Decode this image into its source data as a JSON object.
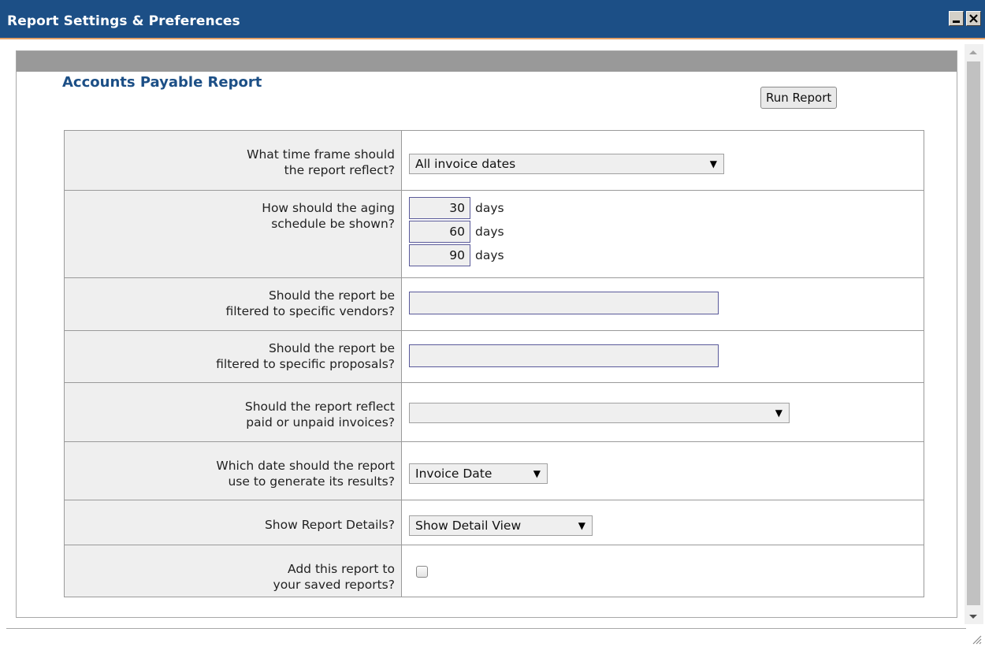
{
  "window": {
    "title": "Report Settings & Preferences"
  },
  "report": {
    "title": "Accounts Payable Report",
    "run_button": "Run Report"
  },
  "form": {
    "time_frame": {
      "question_line1": "What time frame should",
      "question_line2": "the report reflect?",
      "selected": "All invoice dates"
    },
    "aging": {
      "question_line1": "How should the aging",
      "question_line2": "schedule be shown?",
      "day1": "30",
      "day2": "60",
      "day3": "90",
      "unit": "days"
    },
    "vendors": {
      "question_line1": "Should the report be",
      "question_line2": "filtered to specific vendors?",
      "value": ""
    },
    "proposals": {
      "question_line1": "Should the report be",
      "question_line2": "filtered to specific proposals?",
      "value": ""
    },
    "paid_unpaid": {
      "question_line1": "Should the report reflect",
      "question_line2": "paid or unpaid invoices?",
      "selected": ""
    },
    "date_basis": {
      "question_line1": "Which date should the report",
      "question_line2": "use to generate its results?",
      "selected": "Invoice Date"
    },
    "details": {
      "question": "Show Report Details?",
      "selected": "Show Detail View"
    },
    "save": {
      "question_line1": "Add this report to",
      "question_line2": "your saved reports?",
      "checked": false
    }
  },
  "colors": {
    "titlebar": "#1c4f86",
    "titlebar_accent": "#e4a066",
    "heading": "#1c4f86",
    "question_bg": "#efefef"
  },
  "icons": {
    "minimize": "minimize-icon",
    "close": "close-icon",
    "dropdown": "dropdown-arrow-icon",
    "resize": "resize-grip-icon"
  }
}
